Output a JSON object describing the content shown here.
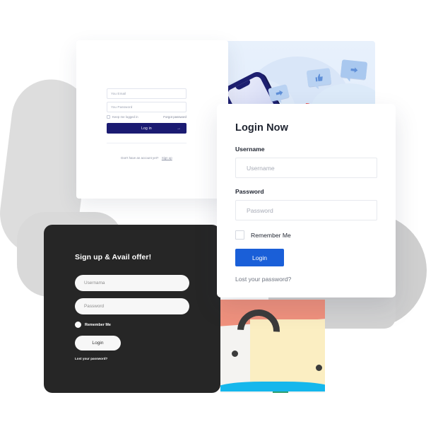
{
  "main_card": {
    "title": "Login Now",
    "username_label": "Username",
    "username_placeholder": "Username",
    "username_value": "",
    "password_label": "Password",
    "password_placeholder": "Password",
    "password_value": "",
    "remember_label": "Remember Me",
    "login_button": "Login",
    "lost_password": "Lost your password?",
    "accent_color": "#1a5fd8"
  },
  "white_card": {
    "email_placeholder": "You Email",
    "password_placeholder": "You Password",
    "keep_logged_label": "Keep me logged in",
    "forgot_label": "Forgot password",
    "login_button": "Log in",
    "arrow_icon": "→",
    "signup_prompt": "Don't have an account yet?",
    "signup_link": "Sign up",
    "button_color": "#1b1b72"
  },
  "dark_card": {
    "title": "Sign up & Avail offer!",
    "username_placeholder": "Usernama",
    "password_placeholder": "Password",
    "remember_label": "Remember Me",
    "login_button": "Login",
    "lost_password": "Lost your password?",
    "background_color": "#262626"
  },
  "illustration_top": {
    "name": "social-engagement-illustration",
    "background_color": "#e8f1fc",
    "phone_color": "#1d1f70",
    "heart_color": "#e8403f",
    "bubble_color": "#b9d2f2"
  },
  "illustration_bottom": {
    "name": "abstract-shapes-illustration",
    "coral_color": "#f0917d",
    "cream_color": "#fbeec2",
    "arc_color": "#3b3b3b",
    "water_color": "#15b7ec"
  }
}
